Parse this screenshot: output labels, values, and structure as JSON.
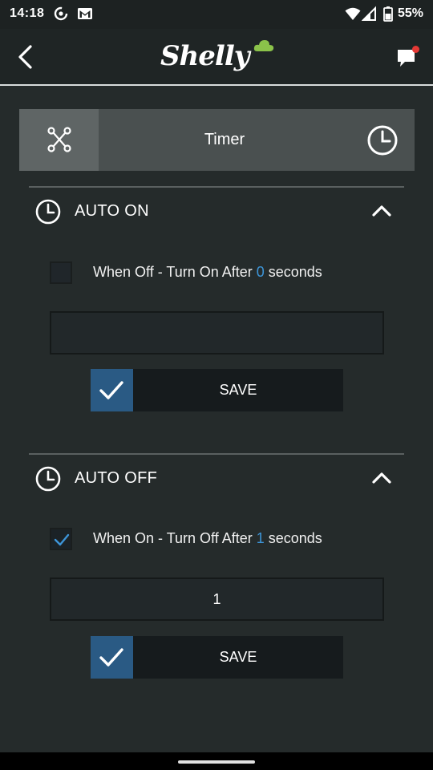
{
  "status_bar": {
    "time": "14:18",
    "battery": "55%",
    "left_icons": [
      "sync-icon",
      "gmail-icon"
    ],
    "right_icons": [
      "wifi-icon",
      "signal-icon",
      "battery-icon"
    ]
  },
  "app_bar": {
    "logo_text": "Shelly",
    "accent_color": "#8bc34a",
    "notification_color": "#e53935"
  },
  "tabs": {
    "title": "Timer",
    "left_icon": "schedule-nodes-icon",
    "right_icon": "clock-icon"
  },
  "auto_on": {
    "title": "AUTO ON",
    "checkbox_checked": false,
    "label_prefix": "When Off - Turn On After ",
    "seconds_value": "0",
    "label_suffix": " seconds",
    "input_value": "",
    "save_label": "SAVE"
  },
  "auto_off": {
    "title": "AUTO OFF",
    "checkbox_checked": true,
    "label_prefix": "When On - Turn Off After ",
    "seconds_value": "1",
    "label_suffix": " seconds",
    "input_value": "1",
    "save_label": "SAVE"
  },
  "colors": {
    "background": "#252b2b",
    "highlight_number": "#3d95d8",
    "save_check_bg": "#2a5a84"
  }
}
